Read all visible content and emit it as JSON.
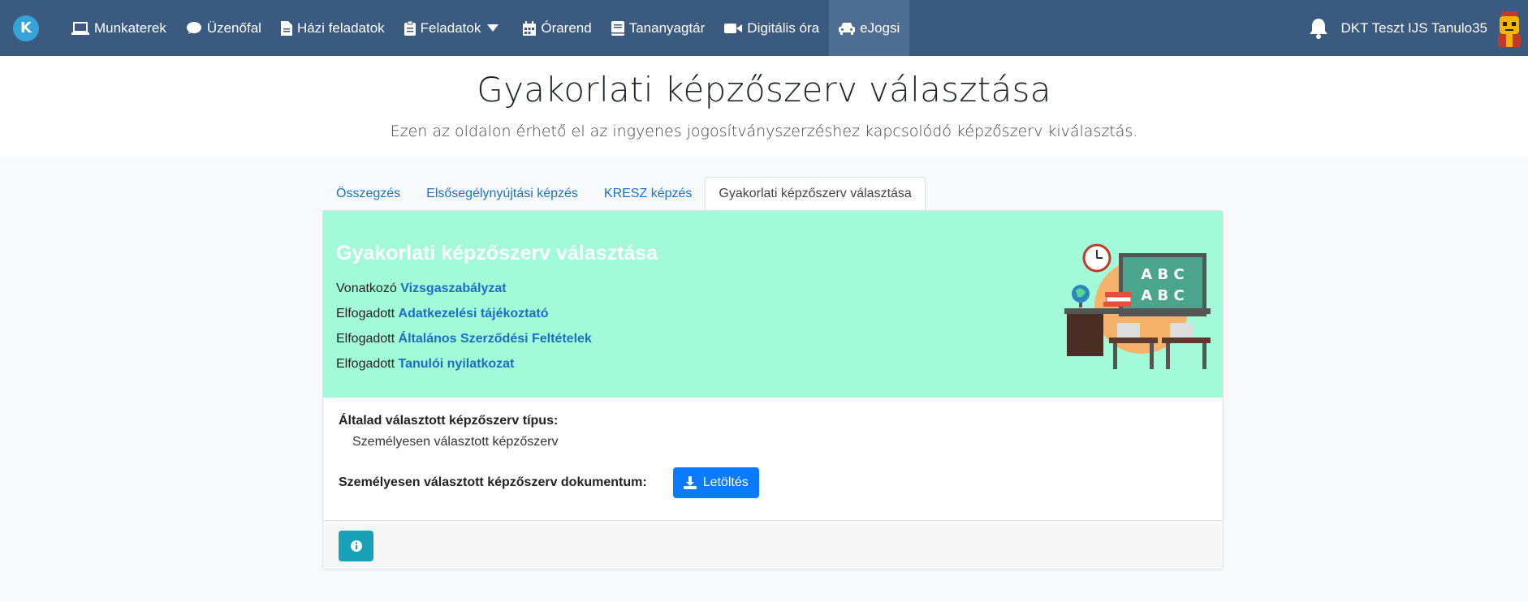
{
  "navbar": {
    "brand_letter": "K",
    "items": [
      {
        "label": "Munkaterek",
        "icon": "laptop-icon"
      },
      {
        "label": "Üzenőfal",
        "icon": "comment-icon"
      },
      {
        "label": "Házi feladatok",
        "icon": "file-icon"
      },
      {
        "label": "Feladatok",
        "icon": "clipboard-icon"
      },
      {
        "label": "Órarend",
        "icon": "calendar-icon"
      },
      {
        "label": "Tananyagtár",
        "icon": "book-icon"
      },
      {
        "label": "Digitális óra",
        "icon": "video-icon"
      },
      {
        "label": "eJogsi",
        "icon": "car-icon"
      }
    ],
    "user_name": "DKT Teszt IJS Tanulo35"
  },
  "header": {
    "title": "Gyakorlati képzőszerv választása",
    "subtitle": "Ezen az oldalon érhető el az ingyenes jogosítványszerzéshez kapcsolódó képzőszerv kiválasztás."
  },
  "tabs": [
    {
      "label": "Összegzés"
    },
    {
      "label": "Elsősegélynyújtási képzés"
    },
    {
      "label": "KRESZ képzés"
    },
    {
      "label": "Gyakorlati képzőszerv választása"
    }
  ],
  "banner": {
    "title": "Gyakorlati képzőszerv választása",
    "lines": [
      {
        "prefix": "Vonatkozó",
        "link": "Vizsgaszabályzat"
      },
      {
        "prefix": "Elfogadott",
        "link": "Adatkezelési tájékoztató"
      },
      {
        "prefix": "Elfogadott",
        "link": "Általános Szerződési Feltételek"
      },
      {
        "prefix": "Elfogadott",
        "link": "Tanulói nyilatkozat"
      }
    ],
    "board_row1": "A B C",
    "board_row2": "A B C"
  },
  "details": {
    "type_label": "Általad választott képzőszerv típus:",
    "type_value": "Személyesen választott képzőszerv",
    "doc_label": "Személyesen választott képzőszerv dokumentum:",
    "download_label": "Letöltés"
  },
  "colors": {
    "navbar": "#3b5a80",
    "banner": "#a3fad9",
    "primary": "#0a7bff",
    "info": "#17a2b8"
  }
}
